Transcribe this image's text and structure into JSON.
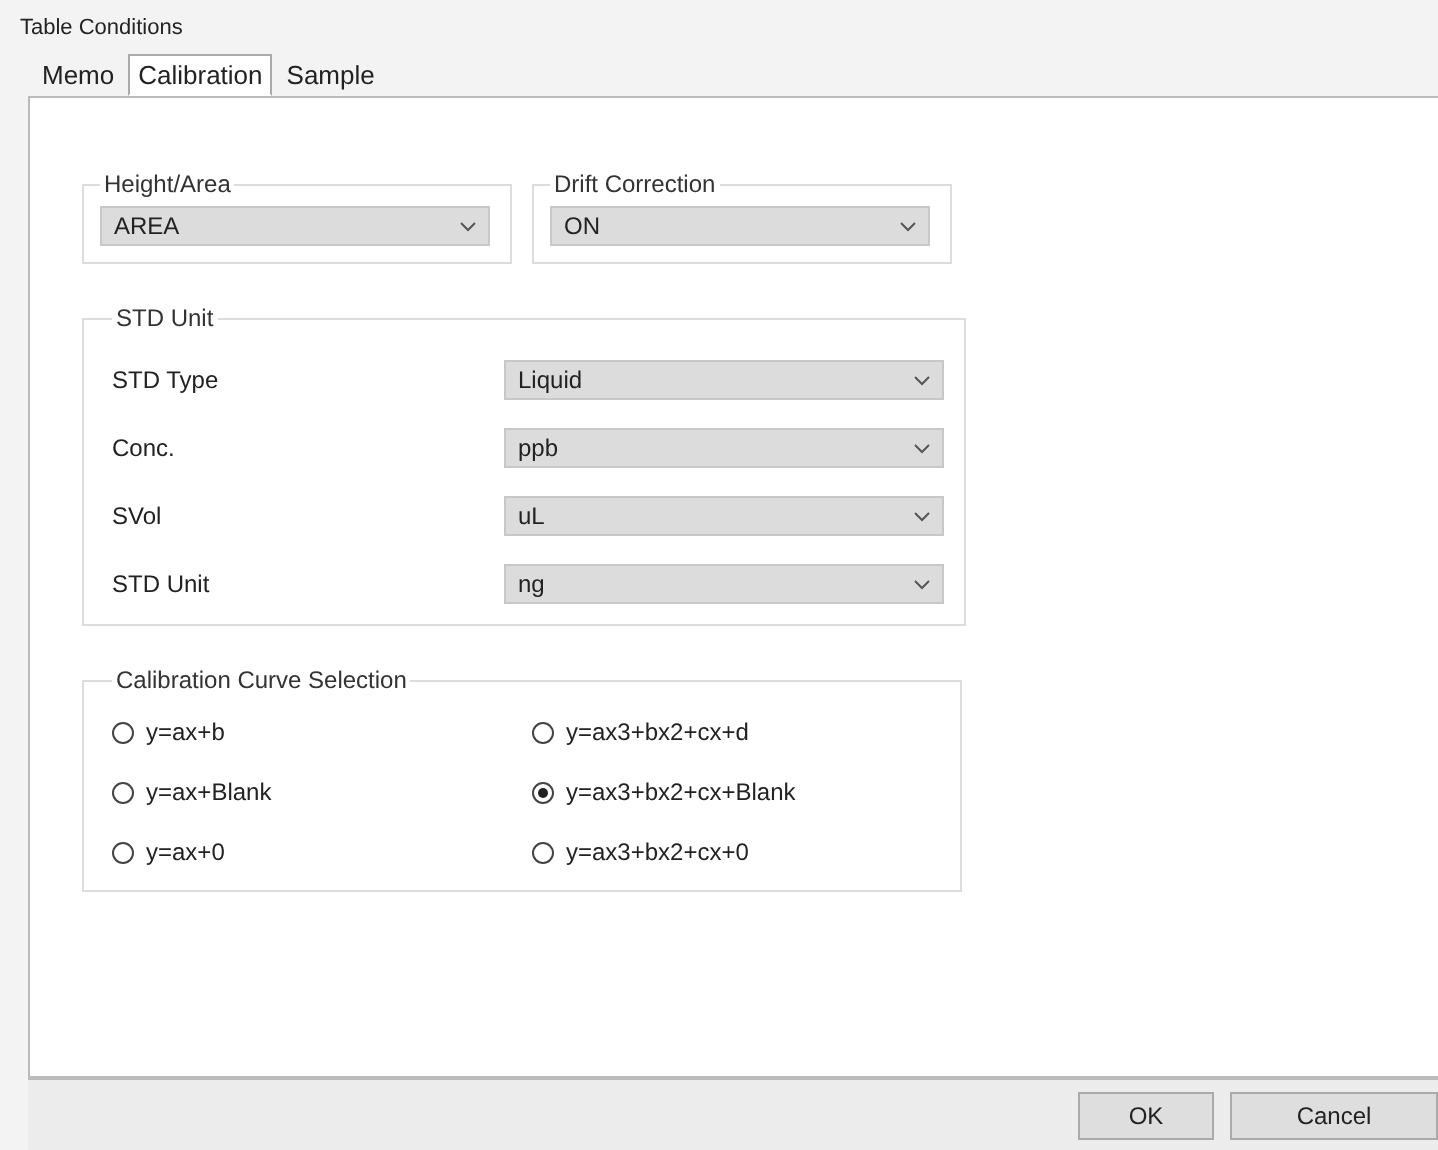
{
  "window": {
    "title": "Table Conditions"
  },
  "tabs": [
    {
      "label": "Memo",
      "selected": false
    },
    {
      "label": "Calibration",
      "selected": true
    },
    {
      "label": "Sample",
      "selected": false
    }
  ],
  "top_groups": [
    {
      "title": "Height/Area",
      "value": "AREA"
    },
    {
      "title": "Drift Correction",
      "value": "ON"
    }
  ],
  "std_unit": {
    "title": "STD Unit",
    "rows": [
      {
        "label": "STD Type",
        "value": "Liquid"
      },
      {
        "label": "Conc.",
        "value": "ppb"
      },
      {
        "label": "SVol",
        "value": "uL"
      },
      {
        "label": "STD Unit",
        "value": "ng"
      }
    ]
  },
  "curve_selection": {
    "title": "Calibration Curve Selection",
    "options": [
      {
        "label": "y=ax+b",
        "selected": false
      },
      {
        "label": "y=ax3+bx2+cx+d",
        "selected": false
      },
      {
        "label": "y=ax+Blank",
        "selected": false
      },
      {
        "label": "y=ax3+bx2+cx+Blank",
        "selected": true
      },
      {
        "label": "y=ax+0",
        "selected": false
      },
      {
        "label": "y=ax3+bx2+cx+0",
        "selected": false
      }
    ]
  },
  "buttons": [
    "OK",
    "Cancel"
  ]
}
